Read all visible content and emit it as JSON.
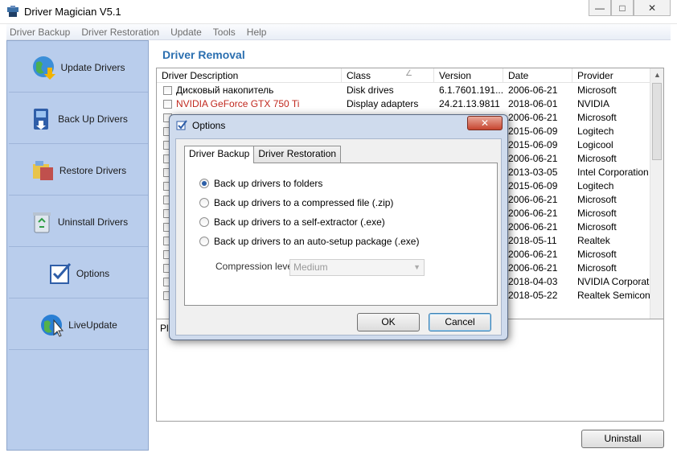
{
  "window": {
    "title": "Driver Magician V5.1",
    "min": "—",
    "max": "□",
    "close": "✕"
  },
  "menu": [
    "Driver Backup",
    "Driver Restoration",
    "Update",
    "Tools",
    "Help"
  ],
  "sidebar": [
    {
      "label": "Update Drivers",
      "icon": "globe-update-icon"
    },
    {
      "label": "Back Up Drivers",
      "icon": "backup-icon"
    },
    {
      "label": "Restore Drivers",
      "icon": "restore-icon"
    },
    {
      "label": "Uninstall Drivers",
      "icon": "recycle-bin-icon"
    },
    {
      "label": "Options",
      "icon": "options-icon"
    },
    {
      "label": "LiveUpdate",
      "icon": "liveupdate-icon"
    }
  ],
  "main": {
    "title": "Driver Removal",
    "columns": [
      "Driver Description",
      "Class",
      "Version",
      "Date",
      "Provider"
    ],
    "sort_indicator": "∠",
    "rows": [
      {
        "desc": "Дисковый накопитель",
        "class": "Disk drives",
        "version": "6.1.7601.191...",
        "date": "2006-06-21",
        "provider": "Microsoft",
        "highlight": false
      },
      {
        "desc": "NVIDIA GeForce GTX 750 Ti",
        "class": "Display adapters",
        "version": "24.21.13.9811",
        "date": "2018-06-01",
        "provider": "NVIDIA",
        "highlight": true
      },
      {
        "desc": "",
        "class": "",
        "version": "",
        "date": "2006-06-21",
        "provider": "Microsoft",
        "highlight": false
      },
      {
        "desc": "",
        "class": "",
        "version": "",
        "date": "2015-06-09",
        "provider": "Logitech",
        "highlight": false
      },
      {
        "desc": "",
        "class": "",
        "version": "",
        "date": "2015-06-09",
        "provider": "Logicool",
        "highlight": false
      },
      {
        "desc": "",
        "class": "",
        "version": "",
        "date": "2006-06-21",
        "provider": "Microsoft",
        "highlight": false
      },
      {
        "desc": "",
        "class": "",
        "version": "",
        "date": "2013-03-05",
        "provider": "Intel Corporation",
        "highlight": false
      },
      {
        "desc": "",
        "class": "",
        "version": "",
        "date": "2015-06-09",
        "provider": "Logitech",
        "highlight": false
      },
      {
        "desc": "",
        "class": "",
        "version": "",
        "date": "2006-06-21",
        "provider": "Microsoft",
        "highlight": false
      },
      {
        "desc": "",
        "class": "",
        "version": "",
        "date": "2006-06-21",
        "provider": "Microsoft",
        "highlight": false
      },
      {
        "desc": "",
        "class": "",
        "version": "",
        "date": "2006-06-21",
        "provider": "Microsoft",
        "highlight": false
      },
      {
        "desc": "",
        "class": "",
        "version": "",
        "date": "2018-05-11",
        "provider": "Realtek",
        "highlight": false
      },
      {
        "desc": "",
        "class": "",
        "version": "",
        "date": "2006-06-21",
        "provider": "Microsoft",
        "highlight": false
      },
      {
        "desc": "",
        "class": "",
        "version": "",
        "date": "2006-06-21",
        "provider": "Microsoft",
        "highlight": false
      },
      {
        "desc": "",
        "class": "",
        "version": "",
        "date": "2018-04-03",
        "provider": "NVIDIA Corporation",
        "highlight": false
      },
      {
        "desc": "",
        "class": "",
        "version": "",
        "date": "2018-05-22",
        "provider": "Realtek Semicondu...",
        "highlight": false
      }
    ],
    "description_text": "Ple",
    "uninstall_button": "Uninstall"
  },
  "dialog": {
    "title": "Options",
    "close": "✕",
    "tabs": [
      "Driver Backup",
      "Driver Restoration"
    ],
    "options": [
      {
        "label": "Back up drivers to folders",
        "selected": true
      },
      {
        "label": "Back up drivers to a compressed file (.zip)",
        "selected": false
      },
      {
        "label": "Back up drivers to a self-extractor (.exe)",
        "selected": false
      },
      {
        "label": "Back up drivers to an auto-setup package (.exe)",
        "selected": false
      }
    ],
    "compression_label": "Compression level",
    "compression_value": "Medium",
    "ok_label": "OK",
    "cancel_label": "Cancel"
  },
  "colors": {
    "accent": "#2b6fb0",
    "sidebar_bg": "#b9cdec",
    "highlight_text": "#c0281e",
    "dialog_frame": "#cfdbed"
  }
}
